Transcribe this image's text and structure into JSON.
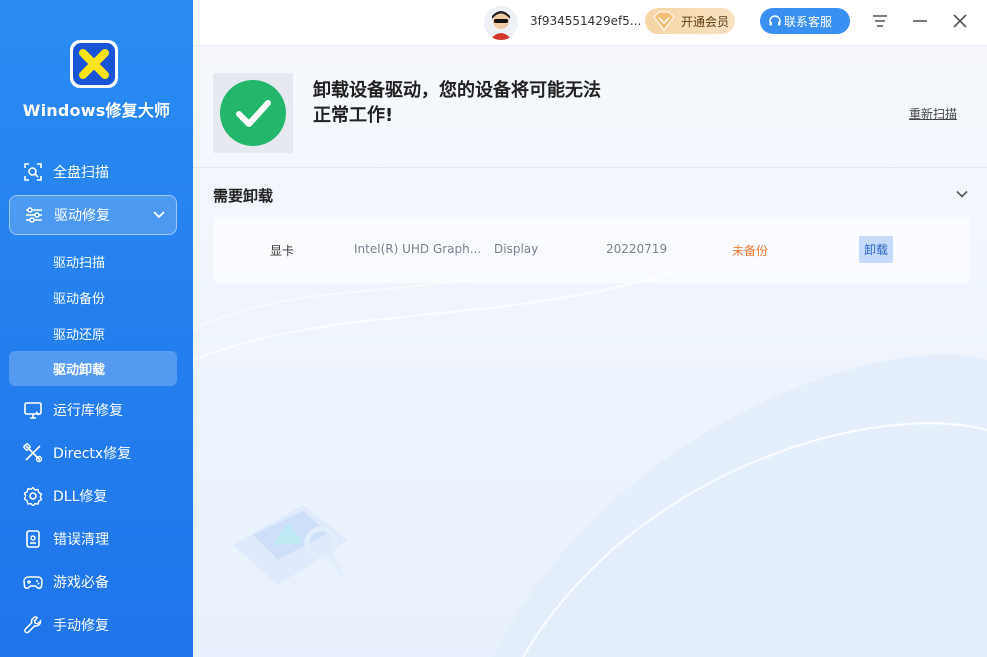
{
  "app": {
    "title": "Windows修复大师"
  },
  "sidebar": {
    "items": [
      {
        "label": "全盘扫描",
        "icon": "scan-icon"
      },
      {
        "label": "驱动修复",
        "icon": "sliders-icon",
        "expanded": true
      },
      {
        "label": "运行库修复",
        "icon": "monitor-icon"
      },
      {
        "label": "Directx修复",
        "icon": "tools-icon"
      },
      {
        "label": "DLL修复",
        "icon": "gear-icon"
      },
      {
        "label": "错误清理",
        "icon": "clipboard-icon"
      },
      {
        "label": "游戏必备",
        "icon": "gamepad-icon"
      },
      {
        "label": "手动修复",
        "icon": "wrench-icon"
      }
    ],
    "sub_items": [
      {
        "label": "驱动扫描"
      },
      {
        "label": "驱动备份"
      },
      {
        "label": "驱动还原"
      },
      {
        "label": "驱动卸载",
        "active": true
      }
    ]
  },
  "topbar": {
    "username": "3f934551429ef5...",
    "vip_label": "开通会员",
    "support_label": "联系客服"
  },
  "result": {
    "message_line1": "卸载设备驱动，您的设备将可能无法",
    "message_line2": "正常工作!",
    "rescan_label": "重新扫描"
  },
  "section": {
    "title": "需要卸载"
  },
  "drivers": [
    {
      "type": "显卡",
      "name": "Intel(R) UHD Graph...",
      "class": "Display",
      "date": "20220719",
      "status": "未备份",
      "action": "卸载"
    }
  ],
  "colors": {
    "sidebar": "#2a8bf2",
    "success": "#22b76a",
    "warning": "#ef7a2c",
    "accent": "#3a8ff2"
  }
}
